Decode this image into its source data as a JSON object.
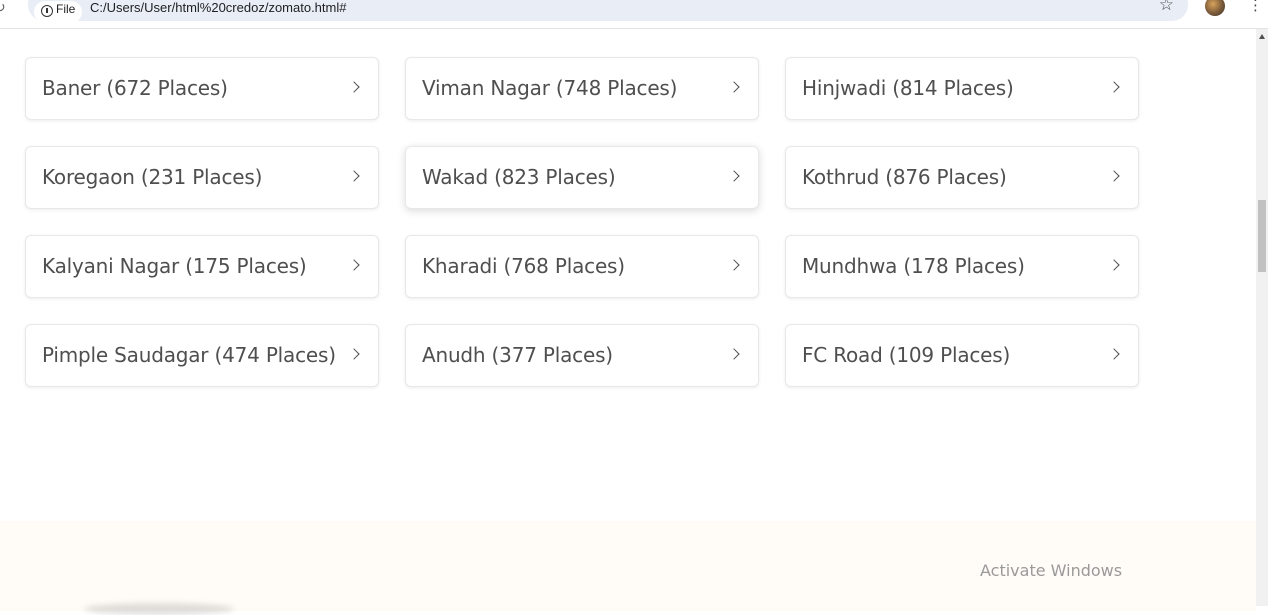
{
  "browser": {
    "site_chip_label": "File",
    "url": "C:/Users/User/html%20credoz/zomato.html#"
  },
  "localities": [
    {
      "label": "Baner (672 Places)"
    },
    {
      "label": "Viman Nagar (748 Places)"
    },
    {
      "label": "Hinjwadi (814 Places)"
    },
    {
      "label": "Koregaon (231 Places)"
    },
    {
      "label": "Wakad (823 Places)"
    },
    {
      "label": "Kothrud (876 Places)"
    },
    {
      "label": "Kalyani Nagar (175 Places)"
    },
    {
      "label": "Kharadi (768 Places)"
    },
    {
      "label": "Mundhwa (178 Places)"
    },
    {
      "label": "Pimple Saudagar (474 Places)"
    },
    {
      "label": "Anudh (377 Places)"
    },
    {
      "label": "FC Road (109 Places)"
    }
  ],
  "watermark": "Activate Windows"
}
